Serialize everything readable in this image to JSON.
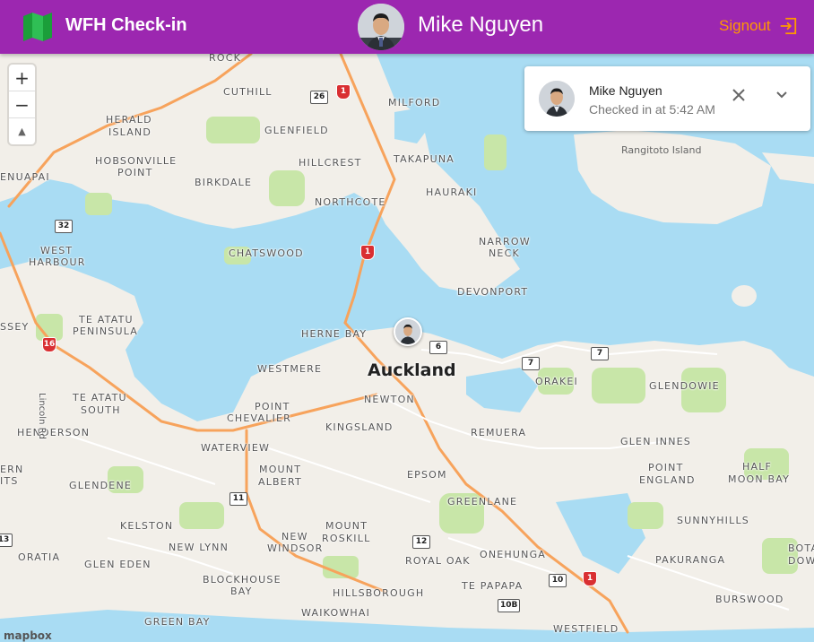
{
  "app": {
    "title": "WFH Check-in",
    "signout_label": "Signout"
  },
  "header": {
    "user_name": "Mike Nguyen"
  },
  "checkin_card": {
    "name": "Mike Nguyen",
    "status": "Checked in at 5:42 AM"
  },
  "map": {
    "city_label": "Auckland",
    "island_label": "Rangitoto Island",
    "zoom_in_label": "+",
    "zoom_out_label": "−",
    "compass_label": "▲",
    "attribution": "mapbox",
    "suburbs": [
      "ROCK",
      "CUTHILL",
      "MILFORD",
      "HERALD",
      "ISLAND",
      "GLENFIELD",
      "HOBSONVILLE",
      "POINT",
      "HILLCREST",
      "TAKAPUNA",
      "BIRKDALE",
      "HAURAKI",
      "ENUAPAI",
      "NORTHCOTE",
      "WEST",
      "HARBOUR",
      "CHATSWOOD",
      "NARROW",
      "NECK",
      "DEVONPORT",
      "TE ATATU",
      "PENINSULA",
      "HERNE BAY",
      "SSEY",
      "WESTMERE",
      "ORAKEI",
      "GLENDOWIE",
      "TE ATATU",
      "SOUTH",
      "POINT",
      "CHEVALIER",
      "NEWTON",
      "KINGSLAND",
      "REMUERA",
      "HENDERSON",
      "WATERVIEW",
      "GLEN INNES",
      "ERN",
      "ITS",
      "MOUNT",
      "ALBERT",
      "EPSOM",
      "POINT",
      "ENGLAND",
      "HALF",
      "MOON BAY",
      "GLENDENE",
      "GREENLANE",
      "KELSTON",
      "SUNNYHILLS",
      "NEW",
      "WINDSOR",
      "MOUNT",
      "ROSKILL",
      "BOTA",
      "DOWN",
      "NEW LYNN",
      "ORATIA",
      "GLEN EDEN",
      "ROYAL OAK",
      "ONEHUNGA",
      "PAKURANGA",
      "BLOCKHOUSE",
      "BAY",
      "TE PAPAPA",
      "HILLSBOROUGH",
      "BURSWOOD",
      "WAIKOWHAI",
      "GREEN BAY",
      "WESTFIELD"
    ],
    "road_label": "Lincoln Rd",
    "shields": [
      "26",
      "1",
      "32",
      "1",
      "16",
      "6",
      "7",
      "7",
      "11",
      "12",
      "10",
      "1",
      "10B",
      "13"
    ]
  },
  "colors": {
    "appbar": "#9c27b0",
    "accent": "#ff9800",
    "water": "#a9dcf3",
    "land": "#f2efe9",
    "park": "#c8e6a8",
    "road": "#f7a35c"
  }
}
